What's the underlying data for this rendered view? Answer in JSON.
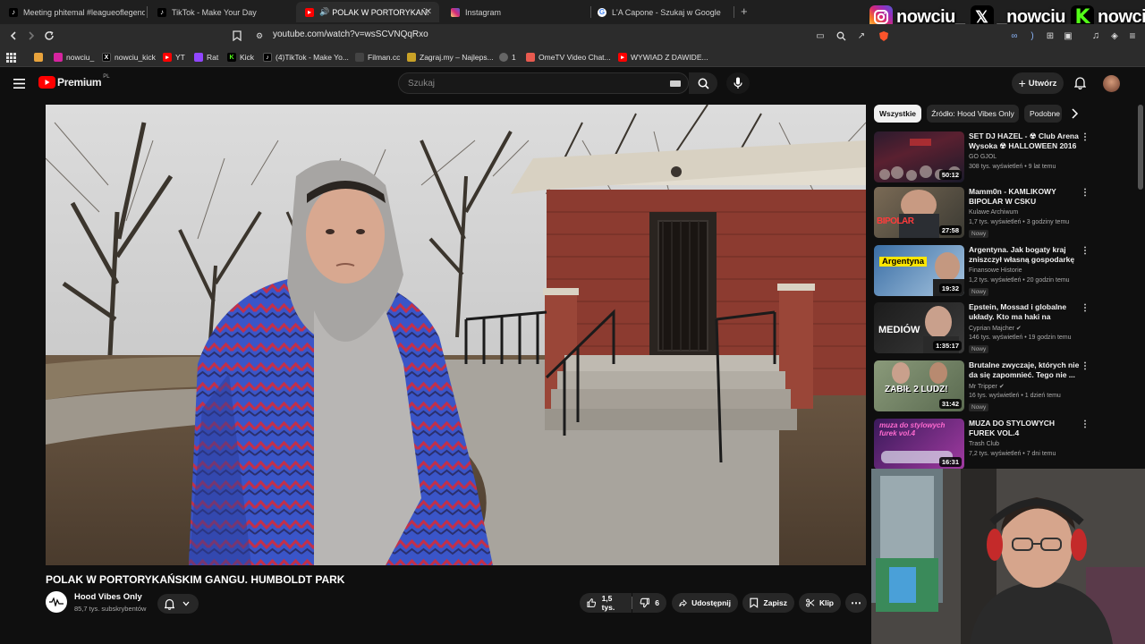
{
  "browser": {
    "tabs": [
      {
        "label": "Meeting phitemal #leagueoflegends",
        "icon": "tiktok-icon"
      },
      {
        "label": "TikTok - Make Your Day",
        "icon": "tiktok-icon"
      },
      {
        "label": "POLAK W PORTORYKAŃSKIM",
        "icon": "youtube-icon",
        "active": true
      },
      {
        "label": "Instagram",
        "icon": "instagram-icon"
      },
      {
        "label": "L'A Capone - Szukaj w Google",
        "icon": "google-icon"
      }
    ],
    "new_tab": "+",
    "url": "youtube.com/watch?v=wsSCVNQqRxo",
    "bookmarks": [
      {
        "label": "",
        "icon": "folder-icon",
        "color": "#e8a33c"
      },
      {
        "label": "nowciu_",
        "icon": "instagram-icon",
        "color": "#d6249f"
      },
      {
        "label": "nowciu_kick",
        "icon": "x-icon",
        "color": "#000000"
      },
      {
        "label": "YT",
        "icon": "youtube-icon",
        "color": "#ff0000"
      },
      {
        "label": "Rat",
        "icon": "twitch-icon",
        "color": "#9146ff"
      },
      {
        "label": "Kick",
        "icon": "kick-icon",
        "color": "#53fc18"
      },
      {
        "label": "(4)TikTok - Make Yo...",
        "icon": "tiktok-icon",
        "color": "#000000"
      },
      {
        "label": "Filman.cc",
        "icon": "filman-icon",
        "color": "#444444"
      },
      {
        "label": "Zagraj.my – Najleps...",
        "icon": "zagraj-icon",
        "color": "#c9a227"
      },
      {
        "label": "1",
        "icon": "globe-icon",
        "color": "#666666"
      },
      {
        "label": "OmeTV Video Chat...",
        "icon": "ometv-icon",
        "color": "#e85a4f"
      },
      {
        "label": "WYWIAD Z DAWIDE...",
        "icon": "youtube-icon",
        "color": "#ff0000"
      }
    ]
  },
  "overlay": {
    "socials": [
      {
        "icon": "instagram-icon",
        "handle": "nowciu_"
      },
      {
        "icon": "x-icon",
        "handle": "_nowciu"
      },
      {
        "icon": "kick-icon",
        "handle": "nowciu"
      }
    ]
  },
  "youtube": {
    "logo_text": "Premium",
    "logo_region": "PL",
    "search_placeholder": "Szukaj",
    "create_label": "Utwórz",
    "video": {
      "title": "POLAK W PORTORYKAŃSKIM GANGU. HUMBOLDT PARK",
      "channel": "Hood Vibes Only",
      "subscribers": "85,7 tys. subskrybentów",
      "likes": "1,5 tys.",
      "dislikes": "6",
      "share_label": "Udostępnij",
      "save_label": "Zapisz",
      "clip_label": "Klip",
      "more": "⋯"
    },
    "chips": [
      "Wszystkie",
      "Źródło: Hood Vibes Only",
      "Podobne"
    ],
    "recommendations": [
      {
        "title": "SET DJ HAZEL - ☢ Club Arena Wysoka ☢ HALLOWEEN 2016 ...",
        "channel": "GO GJOL",
        "meta": "308 tys. wyświetleń • 9 lat temu",
        "duration": "50:12",
        "new": ""
      },
      {
        "title": "Mamm0n - KAMLIKOWY BIPOLAR W CSKU",
        "channel": "Kulawe Archiwum",
        "meta": "1,7 tys. wyświetleń • 3 godziny temu",
        "duration": "27:58",
        "new": "Nowy",
        "thumb_text": "BIPOLAR"
      },
      {
        "title": "Argentyna. Jak bogaty kraj zniszczył własną gospodarkę",
        "channel": "Finansowe Historie",
        "meta": "1,2 tys. wyświetleń • 20 godzin temu",
        "duration": "19:32",
        "new": "Nowy",
        "thumb_text": "Argentyna"
      },
      {
        "title": "Epstein, Mossad i globalne układy. Kto ma haki na polskie...",
        "channel": "Cyprian Majcher ✔",
        "meta": "146 tys. wyświetleń • 19 godzin temu",
        "duration": "1:35:17",
        "new": "Nowy",
        "thumb_text": "MEDIÓW"
      },
      {
        "title": "Brutalne zwyczaje, których nie da się zapomnieć. Tego nie ...",
        "channel": "Mr Tripper ✔",
        "meta": "16 tys. wyświetleń • 1 dzień temu",
        "duration": "31:42",
        "new": "Nowy",
        "thumb_text": "ZABIŁ 2 LUDZ!"
      },
      {
        "title": "MUZA DO STYLOWYCH FUREK VOL.4",
        "channel": "Trash Club",
        "meta": "7,2 tys. wyświetleń • 7 dni temu",
        "duration": "16:31",
        "new": "",
        "thumb_text": "muza do stylowych furek vol.4"
      }
    ]
  }
}
